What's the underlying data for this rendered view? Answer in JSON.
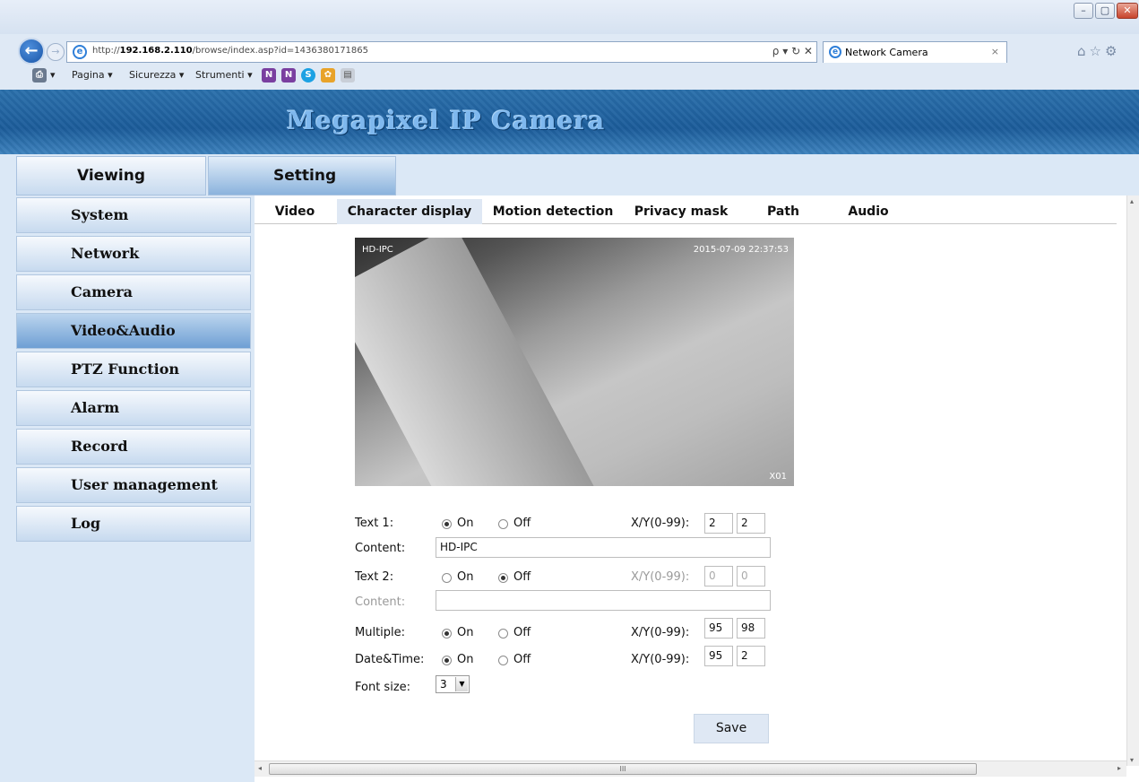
{
  "browser": {
    "url_prefix": "http://",
    "url_host": "192.168.2.110",
    "url_path": "/browse/index.asp?id=1436380171865",
    "addr_tools": "ρ ▾ ↻ ✕",
    "tab_title": "Network Camera",
    "tab_close": "×",
    "window_buttons": [
      "–",
      "▢",
      "✕"
    ],
    "right_icons": "⌂☆⚙",
    "cmd": {
      "print_arrow": "▾",
      "pagina": "Pagina ▾",
      "sicurezza": "Sicurezza ▾",
      "strumenti": "Strumenti ▾"
    }
  },
  "banner": {
    "title": "Megapixel IP Camera"
  },
  "topnav": {
    "viewing": "Viewing",
    "setting": "Setting"
  },
  "sidebar": {
    "items": [
      {
        "label": "System"
      },
      {
        "label": "Network"
      },
      {
        "label": "Camera"
      },
      {
        "label": "Video&Audio"
      },
      {
        "label": "PTZ Function"
      },
      {
        "label": "Alarm"
      },
      {
        "label": "Record"
      },
      {
        "label": "User management"
      },
      {
        "label": "Log"
      }
    ],
    "active_index": 3
  },
  "subtabs": [
    {
      "label": "Video"
    },
    {
      "label": "Character display"
    },
    {
      "label": "Motion detection"
    },
    {
      "label": "Privacy mask"
    },
    {
      "label": "Path"
    },
    {
      "label": "Audio"
    }
  ],
  "preview": {
    "overlay_text1": "HD-IPC",
    "overlay_datetime": "2015-07-09  22:37:53",
    "overlay_multiple": "X01"
  },
  "form": {
    "text1": {
      "label": "Text 1:",
      "on": "On",
      "off": "Off",
      "state": "on",
      "xy_label": "X/Y(0-99):",
      "x": "2",
      "y": "2",
      "content_label": "Content:",
      "content": "HD-IPC"
    },
    "text2": {
      "label": "Text 2:",
      "on": "On",
      "off": "Off",
      "state": "off",
      "xy_label": "X/Y(0-99):",
      "x": "0",
      "y": "0",
      "content_label": "Content:",
      "content": ""
    },
    "multiple": {
      "label": "Multiple:",
      "on": "On",
      "off": "Off",
      "state": "on",
      "xy_label": "X/Y(0-99):",
      "x": "95",
      "y": "98"
    },
    "datetime": {
      "label": "Date&Time:",
      "on": "On",
      "off": "Off",
      "state": "on",
      "xy_label": "X/Y(0-99):",
      "x": "95",
      "y": "2"
    },
    "font_size": {
      "label": "Font size:",
      "value": "3"
    },
    "save_label": "Save"
  },
  "scroll": {
    "hthumb_grip": "III",
    "left": "◂",
    "right": "▸",
    "up": "▴",
    "down": "▾"
  }
}
